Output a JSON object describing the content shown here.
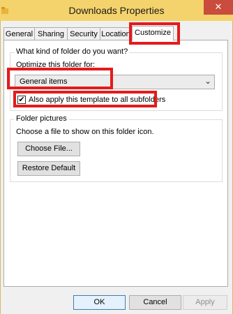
{
  "window": {
    "title": "Downloads Properties",
    "close_glyph": "✕",
    "icon": "folder-icon"
  },
  "tabs": [
    {
      "label": "General"
    },
    {
      "label": "Sharing"
    },
    {
      "label": "Security"
    },
    {
      "label": "Location"
    },
    {
      "label": "Customize",
      "active": true
    }
  ],
  "folder_type_group": {
    "legend": "What kind of folder do you want?",
    "optimize_label": "Optimize this folder for:",
    "optimize_value": "General items",
    "apply_checkbox_label": "Also apply this template to all subfolders",
    "apply_checked": true
  },
  "folder_pictures_group": {
    "legend": "Folder pictures",
    "description": "Choose a file to show on this folder icon.",
    "choose_file_label": "Choose File...",
    "restore_default_label": "Restore Default"
  },
  "footer": {
    "ok_label": "OK",
    "cancel_label": "Cancel",
    "apply_label": "Apply"
  },
  "colors": {
    "titlebar": "#f4d36c",
    "close_button": "#c94c3c",
    "highlight_boxes": "#e41b1b"
  }
}
